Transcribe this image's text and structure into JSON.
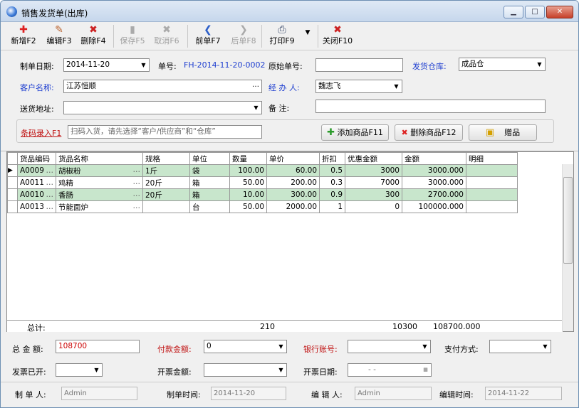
{
  "window": {
    "title": "销售发货单(出库)",
    "min": "▁",
    "max": "□",
    "close": "✕"
  },
  "toolbar": [
    {
      "label": "新增F2",
      "icon": "✚",
      "color": "#d22"
    },
    {
      "label": "编辑F3",
      "icon": "✎",
      "color": "#b63"
    },
    {
      "label": "删除F4",
      "icon": "✖",
      "color": "#c22"
    },
    {
      "label": "保存F5",
      "icon": "▮",
      "color": "#aaa"
    },
    {
      "label": "取消F6",
      "icon": "✖",
      "color": "#aaa"
    },
    {
      "label": "前单F7",
      "icon": "❮",
      "color": "#2d5fc9"
    },
    {
      "label": "后单F8",
      "icon": "❯",
      "color": "#aaa"
    },
    {
      "label": "打印F9",
      "icon": "⎙",
      "color": "#346"
    },
    {
      "label": "关闭F10",
      "icon": "✖",
      "color": "#c22"
    }
  ],
  "form": {
    "date_label": "制单日期:",
    "date_value": "2014-11-20",
    "no_label": "单号:",
    "no_value": "FH-2014-11-20-0002",
    "orig_label": "原始单号:",
    "orig_value": "",
    "warehouse_label": "发货仓库:",
    "warehouse_value": "成品仓",
    "customer_label": "客户名称:",
    "customer_value": "江苏恒顺",
    "handler_label": "经 办 人:",
    "handler_value": "魏志飞",
    "addr_label": "送货地址:",
    "addr_value": "",
    "remark_label": "备   注:",
    "remark_value": "",
    "barcode_label": "条码录入F1",
    "barcode_placeholder": "扫码入货，请先选择“客户/供应商”和“仓库”",
    "add_goods": "添加商品F11",
    "del_goods": "删除商品F12",
    "gift": "赠品"
  },
  "grid": {
    "columns": [
      "货品编码",
      "货品名称",
      "规格",
      "单位",
      "数量",
      "单价",
      "折扣",
      "优惠金额",
      "金额",
      "明细"
    ],
    "rows": [
      {
        "code": "A0009",
        "name": "胡椒粉",
        "spec": "1斤",
        "unit": "袋",
        "qty": "100.00",
        "price": "60.00",
        "disc": "0.5",
        "favor": "3000",
        "amount": "3000.000",
        "detail": ""
      },
      {
        "code": "A0011",
        "name": "鸡精",
        "spec": "20斤",
        "unit": "箱",
        "qty": "50.00",
        "price": "200.00",
        "disc": "0.3",
        "favor": "7000",
        "amount": "3000.000",
        "detail": ""
      },
      {
        "code": "A0010",
        "name": "香肠",
        "spec": "20斤",
        "unit": "箱",
        "qty": "10.00",
        "price": "300.00",
        "disc": "0.9",
        "favor": "300",
        "amount": "2700.000",
        "detail": ""
      },
      {
        "code": "A0013",
        "name": "节能面炉",
        "spec": "",
        "unit": "台",
        "qty": "50.00",
        "price": "2000.00",
        "disc": "1",
        "favor": "0",
        "amount": "100000.000",
        "detail": ""
      }
    ],
    "total_label": "总计:",
    "total_qty": "210",
    "total_favor": "10300",
    "total_amount": "108700.000"
  },
  "footer": {
    "total_label": "总 金 额:",
    "total_value": "108700",
    "pay_label": "付款金额:",
    "pay_value": "0",
    "bank_label": "银行账号:",
    "bank_value": "",
    "method_label": "支付方式:",
    "method_value": "",
    "invoiced_label": "发票已开:",
    "invoiced_value": "",
    "inv_amount_label": "开票金额:",
    "inv_amount_value": "",
    "inv_date_label": "开票日期:",
    "inv_date_value": "-  -",
    "maker_label": "制 单 人:",
    "maker_value": "Admin",
    "make_time_label": "制单时间:",
    "make_time_value": "2014-11-20",
    "editor_label": "编 辑 人:",
    "editor_value": "Admin",
    "edit_time_label": "编辑时间:",
    "edit_time_value": "2014-11-22"
  }
}
